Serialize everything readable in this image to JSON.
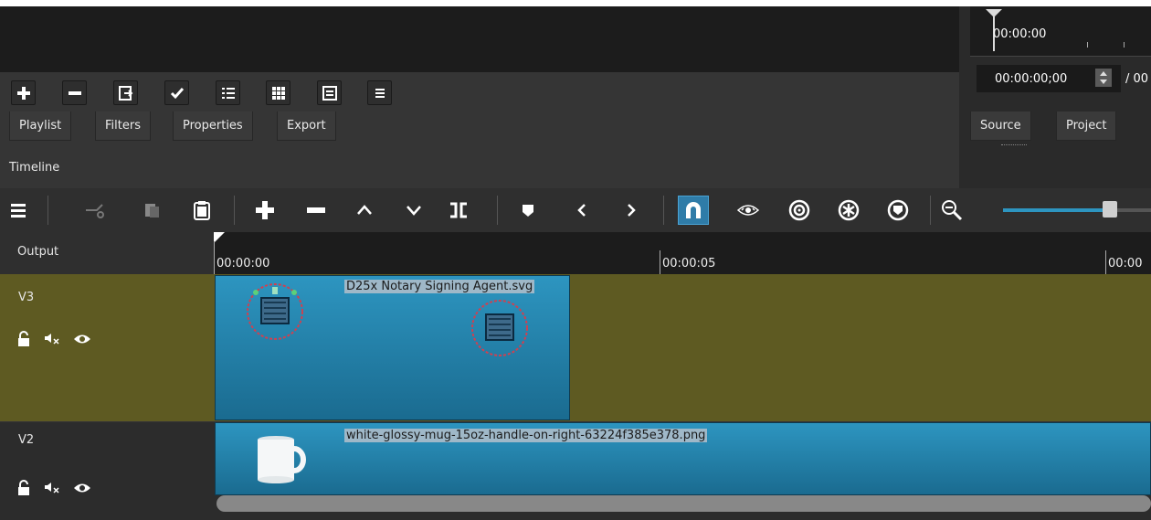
{
  "playlist": {
    "toolbar_icons": [
      "add-icon",
      "remove-icon",
      "update-icon",
      "check-icon",
      "list-view-icon",
      "grid-view-icon",
      "details-view-icon",
      "menu-icon"
    ]
  },
  "tabs": {
    "left": [
      "Playlist",
      "Filters",
      "Properties",
      "Export"
    ],
    "right": [
      "Source",
      "Project"
    ]
  },
  "player": {
    "ruler_time": "00:00:00",
    "timecode": "00:00:00;00",
    "total_separator": "/ 00"
  },
  "timeline": {
    "title": "Timeline",
    "toolbar_icons": [
      "menu-icon",
      "cut-icon",
      "copy-icon",
      "paste-icon",
      "append-icon",
      "remove-icon",
      "lift-icon",
      "overwrite-icon",
      "split-icon",
      "marker-icon",
      "previous-marker-icon",
      "next-marker-icon",
      "snap-icon",
      "scrub-icon",
      "ripple-icon",
      "ripple-all-icon",
      "ripple-markers-icon",
      "zoom-out-icon"
    ],
    "zoom_level": 0.72,
    "output_label": "Output",
    "ruler_ticks": [
      "00:00:00",
      "00:00:05",
      "00:00"
    ],
    "tracks": [
      {
        "name": "V3",
        "clip": "D25x Notary Signing Agent.svg"
      },
      {
        "name": "V2",
        "clip": "white-glossy-mug-15oz-handle-on-right-63224f385e378.png"
      }
    ]
  },
  "colors": {
    "accent": "#2d95c0",
    "v3_track": "#5e5a22",
    "selected": "#2f7ca8"
  }
}
